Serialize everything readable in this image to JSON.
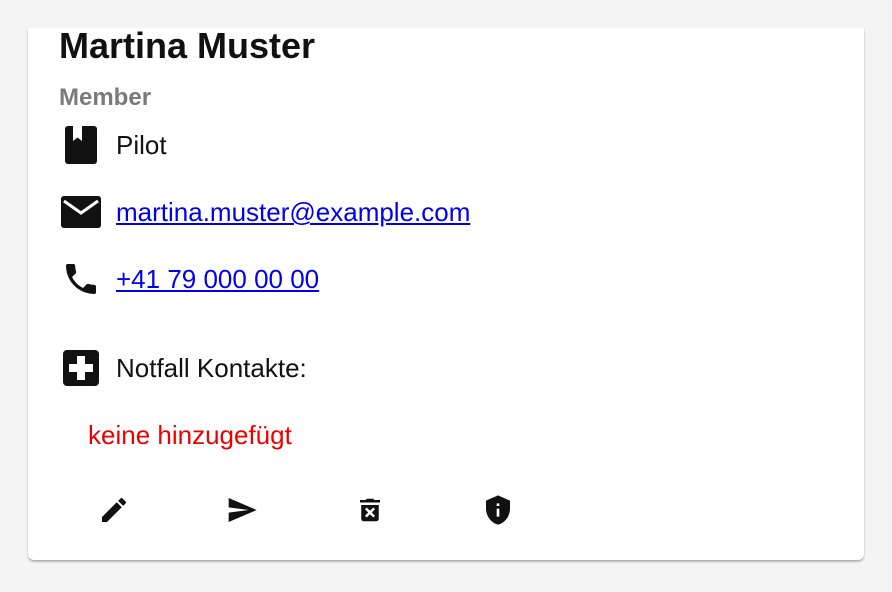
{
  "member": {
    "name": "Martina Muster",
    "role": "Member",
    "job": "Pilot",
    "email": "martina.muster@example.com",
    "phone": "+41 79 000 00 00",
    "emergency_label": "Notfall Kontakte:",
    "emergency_empty": "keine hinzugefügt"
  },
  "icons": {
    "job": "book-icon",
    "email": "mail-icon",
    "phone": "phone-icon",
    "emergency": "medical-cross-icon"
  },
  "actions": [
    {
      "name": "edit-button",
      "icon": "pencil-icon"
    },
    {
      "name": "send-button",
      "icon": "send-icon"
    },
    {
      "name": "delete-button",
      "icon": "trash-icon"
    },
    {
      "name": "admin-button",
      "icon": "shield-icon"
    }
  ],
  "colors": {
    "link": "#0000ee",
    "warning": "#ee0000",
    "muted": "#7a7a7a"
  }
}
